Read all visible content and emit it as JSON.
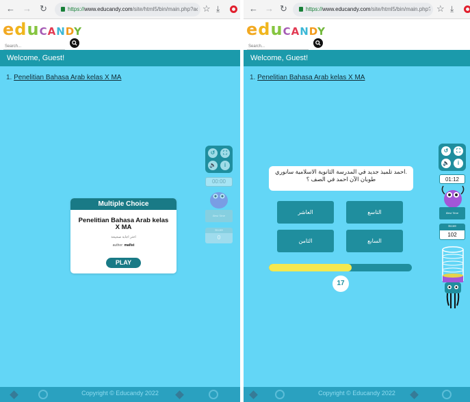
{
  "browser": {
    "url_proto": "https://",
    "url_host": "www.educandy.com",
    "url_path_left": "/site/html5/bin/main.php?ac",
    "url_path_right": "/site/html5/bin/main.php?ac"
  },
  "site": {
    "logo_letters": [
      {
        "ch": "e",
        "color": "#f2a922"
      },
      {
        "ch": "d",
        "color": "#f0b61d"
      },
      {
        "ch": "u",
        "color": "#86c540"
      },
      {
        "ch": "C",
        "color": "#a55ab4"
      },
      {
        "ch": "A",
        "color": "#e23b53"
      },
      {
        "ch": "N",
        "color": "#3bb7d6"
      },
      {
        "ch": "D",
        "color": "#f29a1c"
      },
      {
        "ch": "Y",
        "color": "#72b83c"
      }
    ],
    "search_placeholder": "Search...",
    "welcome": "Welcome, Guest!",
    "list_item_number": "1.",
    "list_item_link": "Penelitian Bahasa Arab kelas X MA",
    "footer_copyright": "Copyright © Educandy 2022"
  },
  "left_game": {
    "card": {
      "header": "Multiple Choice",
      "title": "Penelitian Bahasa Arab kelas X MA",
      "instruction": "اختر اجابة صحيحة",
      "author_label": "author:",
      "author_name": "mafist",
      "play_label": "PLAY"
    },
    "timer": "00:00",
    "best_time_label": "Best Time",
    "score_label": "Score",
    "score_value": "0"
  },
  "right_game": {
    "question": ".احمد تلميذ جديد في المدرسة الثانوية الاسلامية سانوري طوبان الآن احمد في الصف ؟",
    "answers": [
      "التاسع",
      "العاشر",
      "السابع",
      "الثامن"
    ],
    "progress": 0.58,
    "question_number": "17",
    "timer": "01:12",
    "best_time_label": "Best Time",
    "score_label": "Score",
    "score_value": "102"
  },
  "colors": {
    "game_bg": "#63d6f6",
    "teal": "#1f8e9e",
    "progress_fill": "#f4e84f",
    "monster": "#a356d8"
  }
}
